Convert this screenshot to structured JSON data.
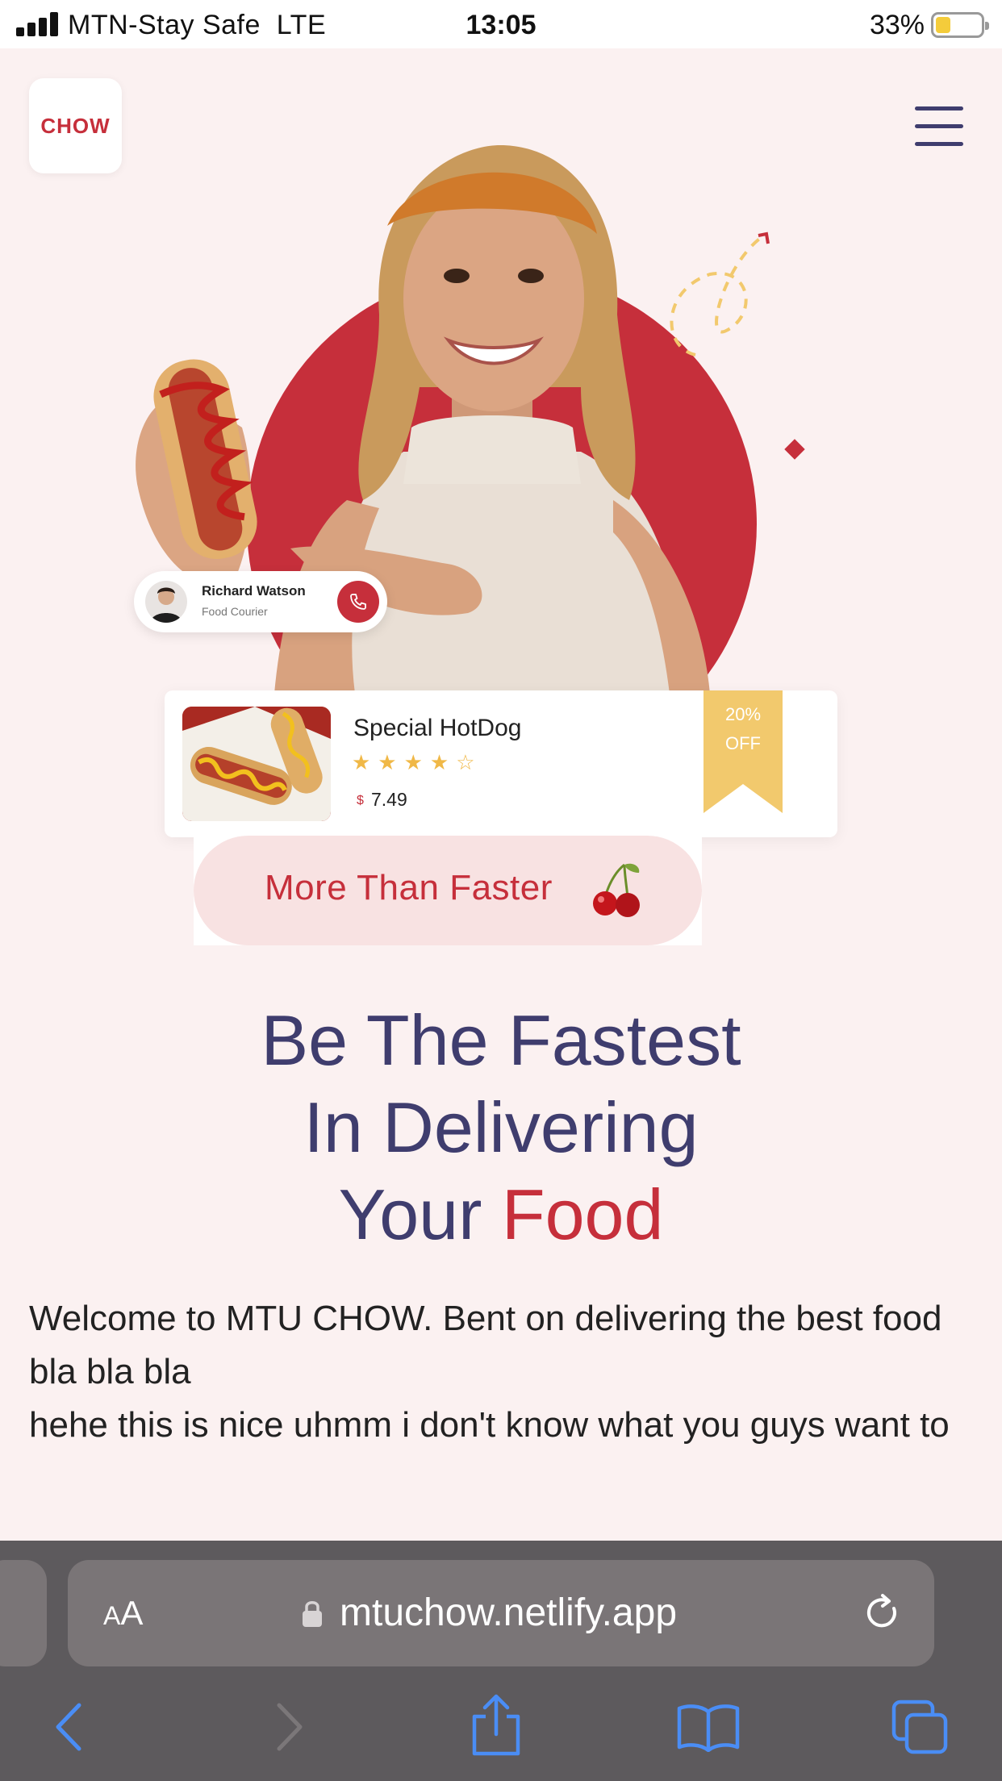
{
  "status_bar": {
    "carrier": "MTN-Stay Safe",
    "network": "LTE",
    "time": "13:05",
    "battery_percent": "33%",
    "battery_level": 0.33
  },
  "header": {
    "logo_text": "CHOW",
    "menu_icon": "hamburger-menu-icon"
  },
  "courier": {
    "name": "Richard Watson",
    "role": "Food Courier",
    "call_icon": "phone-icon"
  },
  "product": {
    "name": "Special HotDog",
    "rating": 4,
    "rating_max": 5,
    "stars": "★★★★☆",
    "currency": "$",
    "price": "7.49",
    "discount_line1": "20%",
    "discount_line2": "OFF"
  },
  "tagline": {
    "label": "More Than Faster",
    "icon": "cherry-icon"
  },
  "headline": {
    "line1": "Be The Fastest",
    "line2": "In Delivering",
    "line3_prefix": "Your",
    "line3_accent": "Food"
  },
  "description": {
    "line1": "Welcome to MTU CHOW. Bent on delivering the best food bla bla bla",
    "line2": "hehe this is nice uhmm i don't know what you guys want to"
  },
  "browser": {
    "text_size_label_small": "A",
    "text_size_label_large": "A",
    "url": "mtuchow.netlify.app"
  },
  "colors": {
    "brand_red": "#c62f3b",
    "navy": "#3f3d6e",
    "page_bg": "#fbf1f1",
    "star_gold": "#f0b847",
    "ribbon_gold": "#f2c96d",
    "browser_blue": "#4a8df5"
  }
}
